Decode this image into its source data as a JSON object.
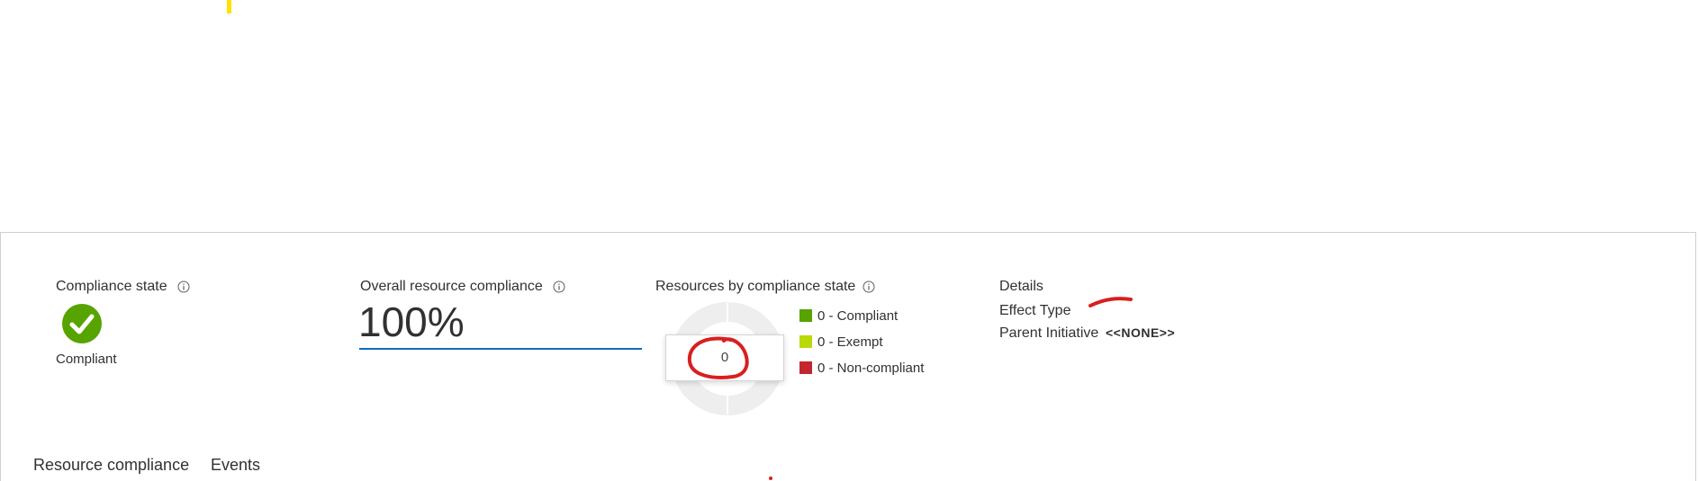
{
  "compliance": {
    "title": "Compliance state",
    "status": "Compliant",
    "icon": "check-circle-icon",
    "color": "#57a300"
  },
  "overall": {
    "title": "Overall resource compliance",
    "value": "100%",
    "underline_color": "#0f6cbd"
  },
  "resources": {
    "title": "Resources by compliance state",
    "tooltip_value": "0",
    "legend": [
      {
        "label": "0 - Compliant",
        "color": "#57a300"
      },
      {
        "label": "0 - Exempt",
        "color": "#bad80a"
      },
      {
        "label": "0 - Non-compliant",
        "color": "#c4262e"
      }
    ]
  },
  "details": {
    "title": "Details",
    "effect_type_label": "Effect Type",
    "parent_initiative_label": "Parent Initiative",
    "parent_initiative_value": "<<NONE>>"
  },
  "tabs": [
    {
      "label": "Resource compliance",
      "active": true
    },
    {
      "label": "Events",
      "active": false
    }
  ],
  "annotation_color": "#d81f1f"
}
